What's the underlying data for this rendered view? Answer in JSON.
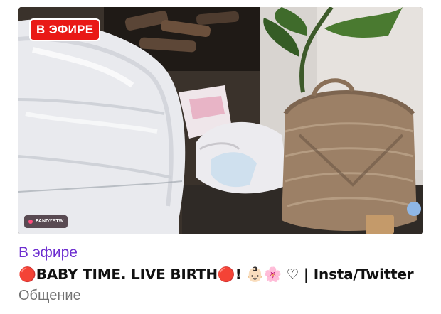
{
  "stream_card": {
    "live_badge": "В ЭФИРЕ",
    "watermark_handle": "FANDYSTW",
    "status_text": "В эфире",
    "title": "🔴BABY TIME. LIVE BIRTH🔴! 👶🏻🌸 ♡ | Insta/Twitter",
    "category": "Общение"
  },
  "colors": {
    "live_red": "#e91916",
    "live_purple": "#6e2fd0",
    "meta_gray": "#737373"
  }
}
